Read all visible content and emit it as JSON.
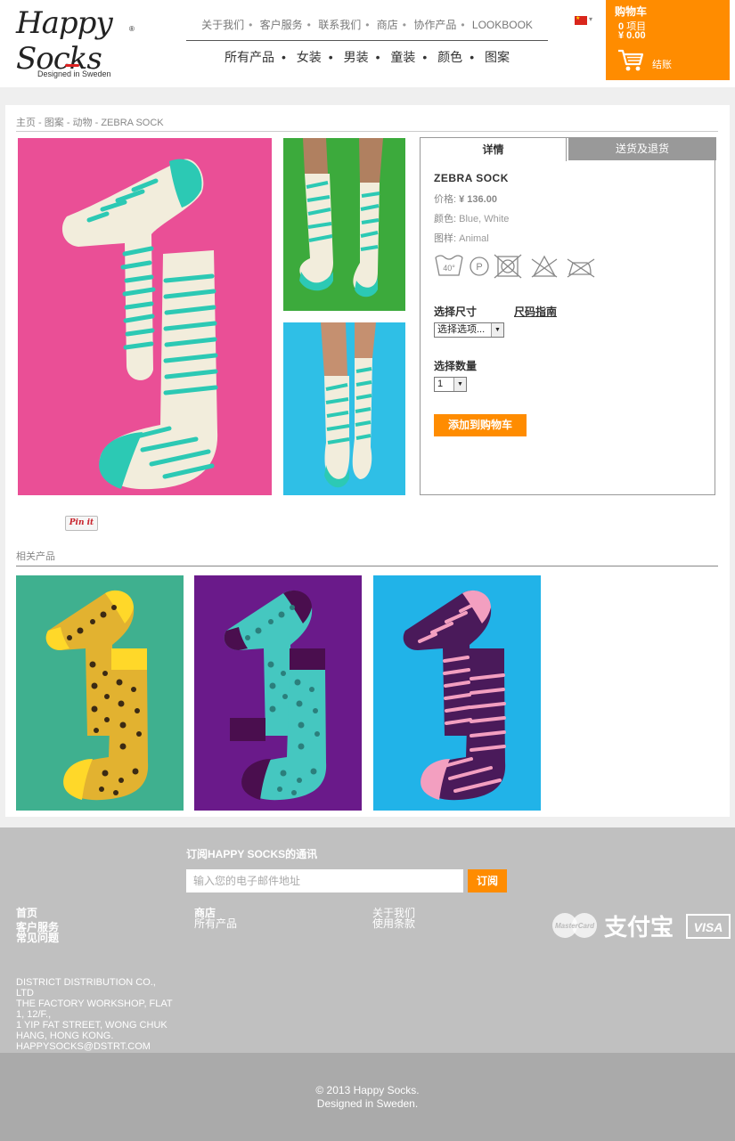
{
  "header": {
    "logo": {
      "text": "Happy Socks",
      "tagline": "Designed in Sweden"
    },
    "top_nav": [
      "关于我们",
      "客户服务",
      "联系我们",
      "商店",
      "协作产品",
      "LOOKBOOK"
    ],
    "main_nav": [
      "所有产品",
      "女装",
      "男装",
      "童装",
      "颜色",
      "图案"
    ],
    "cart": {
      "title": "购物车",
      "items_count": "0",
      "items_label": "项目",
      "total": "¥ 0.00",
      "checkout": "结账"
    }
  },
  "breadcrumb": "主页 - 图案 - 动物 - ZEBRA SOCK",
  "product": {
    "tabs": [
      "详情",
      "送货及退货"
    ],
    "name": "ZEBRA SOCK",
    "price_label": "价格:",
    "price": "¥ 136.00",
    "color_label": "颜色:",
    "color": "Blue, White",
    "pattern_label": "图样:",
    "pattern": "Animal",
    "care_wash_temp": "40°",
    "care_p": "P",
    "size_label": "选择尺寸",
    "size_guide": "尺码指南",
    "size_select": "选择选项...",
    "qty_label": "选择数量",
    "qty_value": "1",
    "add_to_cart": "添加到购物车",
    "pin_label": "Pin it"
  },
  "related": {
    "title": "相关产品",
    "items": [
      {
        "bg": "#3fb08f",
        "name": "leopard-yellow"
      },
      {
        "bg": "#6a1a8a",
        "name": "leopard-turquoise"
      },
      {
        "bg": "#21b3e8",
        "name": "zebra-pink"
      }
    ]
  },
  "footer": {
    "newsletter_title": "订阅HAPPY SOCKS的通讯",
    "newsletter_placeholder": "输入您的电子邮件地址",
    "subscribe": "订阅",
    "col1": [
      "首页",
      "客户服务",
      "常见问题"
    ],
    "col2": [
      "商店",
      "所有产品"
    ],
    "col3": [
      "关于我们",
      "使用条款"
    ],
    "payment": [
      "MasterCard",
      "支付宝",
      "VISA"
    ],
    "address": [
      "DISTRICT DISTRIBUTION CO., LTD",
      "THE FACTORY WORKSHOP, FLAT",
      "1, 12/F.,",
      "1 YIP FAT STREET, WONG CHUK",
      "HANG, HONG KONG.",
      "HAPPYSOCKS@DSTRT.COM"
    ],
    "copyright_1": "© 2013 Happy Socks.",
    "copyright_2": "Designed in Sweden."
  },
  "colors": {
    "accent": "#ff8c00",
    "pink_bg": "#ea4f96",
    "green_bg": "#3caa3c",
    "blue_bg": "#2fbfe6",
    "turquoise": "#2cc9b4"
  }
}
